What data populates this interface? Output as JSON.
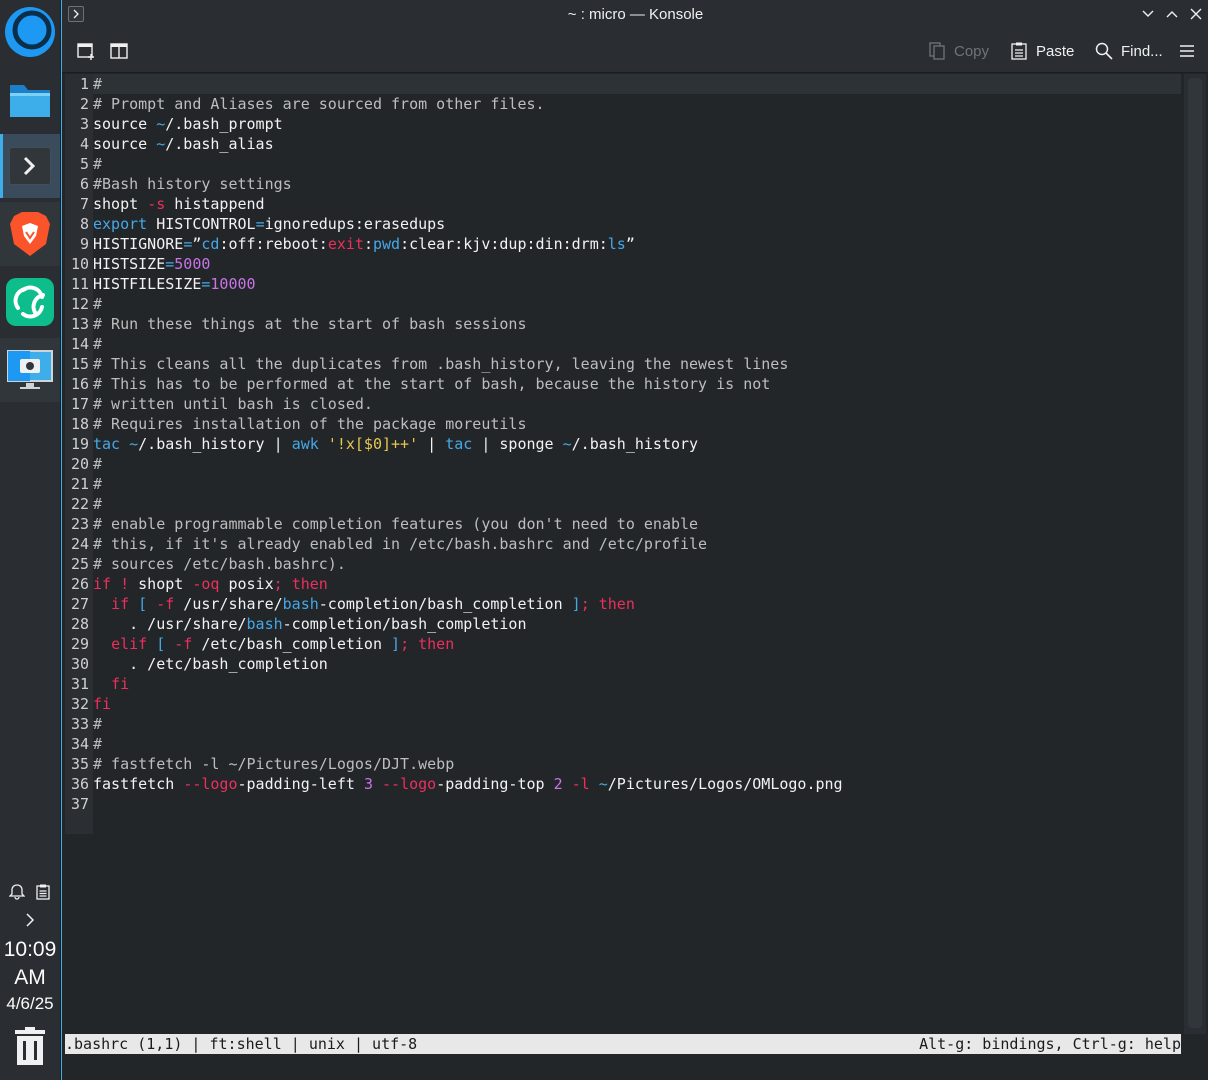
{
  "window": {
    "title": "~ : micro — Konsole"
  },
  "toolbar": {
    "copy_label": "Copy",
    "paste_label": "Paste",
    "find_label": "Find..."
  },
  "panel": {
    "clock_time": "10:09",
    "clock_ampm": "AM",
    "clock_date": "4/6/25",
    "launchers": [
      "app-launcher-icon",
      "file-manager-icon",
      "konsole-icon",
      "brave-browser-icon",
      "element-chat-icon",
      "screenshot-tool-icon"
    ]
  },
  "editor": {
    "lines": [
      {
        "n": "1",
        "html": "<span class=\"c\">#</span>"
      },
      {
        "n": "2",
        "html": "<span class=\"c\"># Prompt and Aliases are sourced from other files.</span>"
      },
      {
        "n": "3",
        "html": "source <span class=\"b\">~</span>/.bash_prompt"
      },
      {
        "n": "4",
        "html": "source <span class=\"b\">~</span>/.bash_alias"
      },
      {
        "n": "5",
        "html": "<span class=\"c\">#</span>"
      },
      {
        "n": "6",
        "html": "<span class=\"c\">#Bash history settings</span>"
      },
      {
        "n": "7",
        "html": "shopt <span class=\"k\">-s</span> histappend"
      },
      {
        "n": "8",
        "html": "<span class=\"b\">export</span> HISTCONTROL<span class=\"b\">=</span>ignoredups:erasedups"
      },
      {
        "n": "9",
        "html": "HISTIGNORE<span class=\"b\">=</span>”<span class=\"b\">cd</span>:off:reboot:<span class=\"k\">exit</span>:<span class=\"b\">pwd</span>:clear:kjv:dup:din:drm:<span class=\"b\">ls</span>”"
      },
      {
        "n": "10",
        "html": "HISTSIZE<span class=\"b\">=</span><span class=\"n\">5000</span>"
      },
      {
        "n": "11",
        "html": "HISTFILESIZE<span class=\"b\">=</span><span class=\"n\">10000</span>"
      },
      {
        "n": "12",
        "html": "<span class=\"c\">#</span>"
      },
      {
        "n": "13",
        "html": "<span class=\"c\"># Run these things at the start of bash sessions</span>"
      },
      {
        "n": "14",
        "html": "<span class=\"c\">#</span>"
      },
      {
        "n": "15",
        "html": "<span class=\"c\"># This cleans all the duplicates from .bash_history, leaving the newest lines</span>"
      },
      {
        "n": "16",
        "html": "<span class=\"c\"># This has to be performed at the start of bash, because the history is not</span>"
      },
      {
        "n": "17",
        "html": "<span class=\"c\"># written until bash is closed.</span>"
      },
      {
        "n": "18",
        "html": "<span class=\"c\"># Requires installation of the package moreutils</span>"
      },
      {
        "n": "19",
        "html": "<span class=\"b\">tac</span> <span class=\"b\">~</span>/.bash_history | <span class=\"b\">awk</span> <span class=\"s\">'!x[$0]++'</span> | <span class=\"b\">tac</span> | sponge <span class=\"b\">~</span>/.bash_history"
      },
      {
        "n": "20",
        "html": "<span class=\"c\">#</span>"
      },
      {
        "n": "21",
        "html": "<span class=\"c\">#</span>"
      },
      {
        "n": "22",
        "html": "<span class=\"c\">#</span>"
      },
      {
        "n": "23",
        "html": "<span class=\"c\"># enable programmable completion features (you don't need to enable</span>"
      },
      {
        "n": "24",
        "html": "<span class=\"c\"># this, if it's already enabled in /etc/bash.bashrc and /etc/profile</span>"
      },
      {
        "n": "25",
        "html": "<span class=\"c\"># sources /etc/bash.bashrc).</span>"
      },
      {
        "n": "26",
        "html": "<span class=\"k\">if</span> <span class=\"k\">!</span> shopt <span class=\"k\">-oq</span> posix<span class=\"k\">;</span> <span class=\"k\">then</span>"
      },
      {
        "n": "27",
        "html": "  <span class=\"k\">if</span> <span class=\"b\">[</span> <span class=\"k\">-f</span> /usr/share/<span class=\"b\">bash</span>-completion/bash_completion <span class=\"b\">]</span><span class=\"k\">;</span> <span class=\"k\">then</span>"
      },
      {
        "n": "28",
        "html": "    . /usr/share/<span class=\"b\">bash</span>-completion/bash_completion"
      },
      {
        "n": "29",
        "html": "  <span class=\"k\">elif</span> <span class=\"b\">[</span> <span class=\"k\">-f</span> /etc/bash_completion <span class=\"b\">]</span><span class=\"k\">;</span> <span class=\"k\">then</span>"
      },
      {
        "n": "30",
        "html": "    . /etc/bash_completion"
      },
      {
        "n": "31",
        "html": "  <span class=\"k\">fi</span>"
      },
      {
        "n": "32",
        "html": "<span class=\"k\">fi</span>"
      },
      {
        "n": "33",
        "html": "<span class=\"c\">#</span>"
      },
      {
        "n": "34",
        "html": "<span class=\"c\">#</span>"
      },
      {
        "n": "35",
        "html": "<span class=\"c\"># fastfetch -l ~/Pictures/Logos/DJT.webp</span>"
      },
      {
        "n": "36",
        "html": "fastfetch <span class=\"k\">--</span><span class=\"k\">logo</span>-padding-left <span class=\"n\">3</span> <span class=\"k\">--</span><span class=\"k\">logo</span>-padding-top <span class=\"n\">2</span> <span class=\"k\">-l</span> <span class=\"b\">~</span>/Pictures/Logos/OMLogo.png"
      },
      {
        "n": "37",
        "html": ""
      }
    ]
  },
  "statusbar": {
    "left": ".bashrc (1,1) | ft:shell | unix | utf-8",
    "right": "Alt-g: bindings, Ctrl-g: help"
  }
}
